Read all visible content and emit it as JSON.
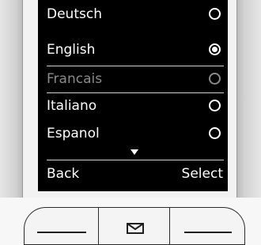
{
  "menu": {
    "items": [
      {
        "label": "Deutsch",
        "selected": false,
        "enabled": true
      },
      {
        "label": "English",
        "selected": true,
        "enabled": true
      },
      {
        "label": "Francais",
        "selected": false,
        "enabled": false
      },
      {
        "label": "Italiano",
        "selected": false,
        "enabled": true
      },
      {
        "label": "Espanol",
        "selected": false,
        "enabled": true
      }
    ]
  },
  "softkeys": {
    "left": "Back",
    "right": "Select"
  },
  "keys": {
    "left_icon": "dash-icon",
    "center_icon": "envelope-icon",
    "right_icon": "dash-icon"
  }
}
